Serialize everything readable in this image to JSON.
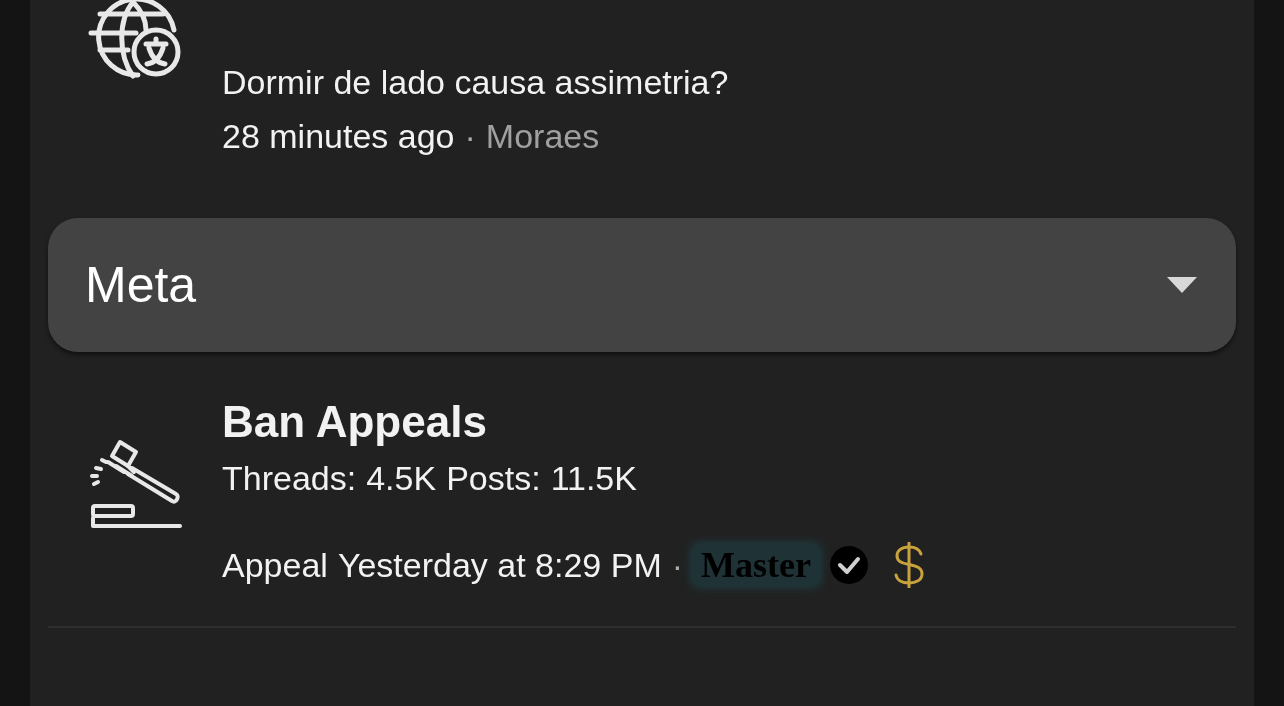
{
  "forums_above": [
    {
      "kind": "globe-translate",
      "last_post_title": "Dormir de lado causa assimetria?",
      "last_post_time": "28 minutes ago",
      "separator": "·",
      "last_post_user": "Moraes"
    }
  ],
  "category": {
    "title": "Meta",
    "expanded": true
  },
  "forums": [
    {
      "kind": "gavel",
      "title": "Ban Appeals",
      "threads_label": "Threads:",
      "threads": "4.5K",
      "posts_label": "Posts:",
      "posts": "11.5K",
      "last_post_title": "Appeal",
      "last_post_time": "Yesterday at 8:29 PM",
      "separator": "·",
      "last_post_user": "Master",
      "user_verified": true,
      "user_donor": true
    }
  ]
}
